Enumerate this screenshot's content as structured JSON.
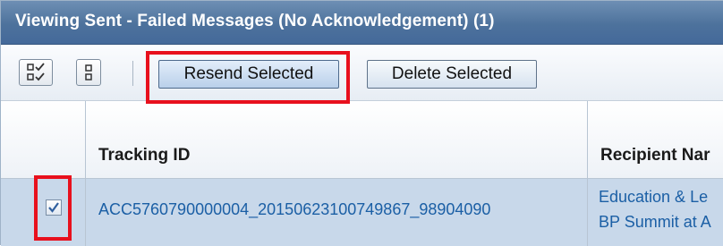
{
  "panel": {
    "title": "Viewing Sent - Failed Messages (No Acknowledgement) (1)"
  },
  "toolbar": {
    "select_all_icon": "select-all-checkmarks-icon",
    "deselect_all_icon": "deselect-all-icon",
    "resend_label": "Resend Selected",
    "delete_label": "Delete Selected"
  },
  "table": {
    "columns": [
      "Tracking ID",
      "Recipient Nar"
    ],
    "rows": [
      {
        "selected": true,
        "tracking_id": "ACC5760790000004_20150623100749867_98904090",
        "recipient_line1": "Education & Le",
        "recipient_line2": "BP Summit at A"
      }
    ]
  },
  "colors": {
    "title_bar": "#4d729c",
    "selected_row": "#c8d8ea",
    "link": "#1b5fa5",
    "annotation": "#e8101d"
  }
}
